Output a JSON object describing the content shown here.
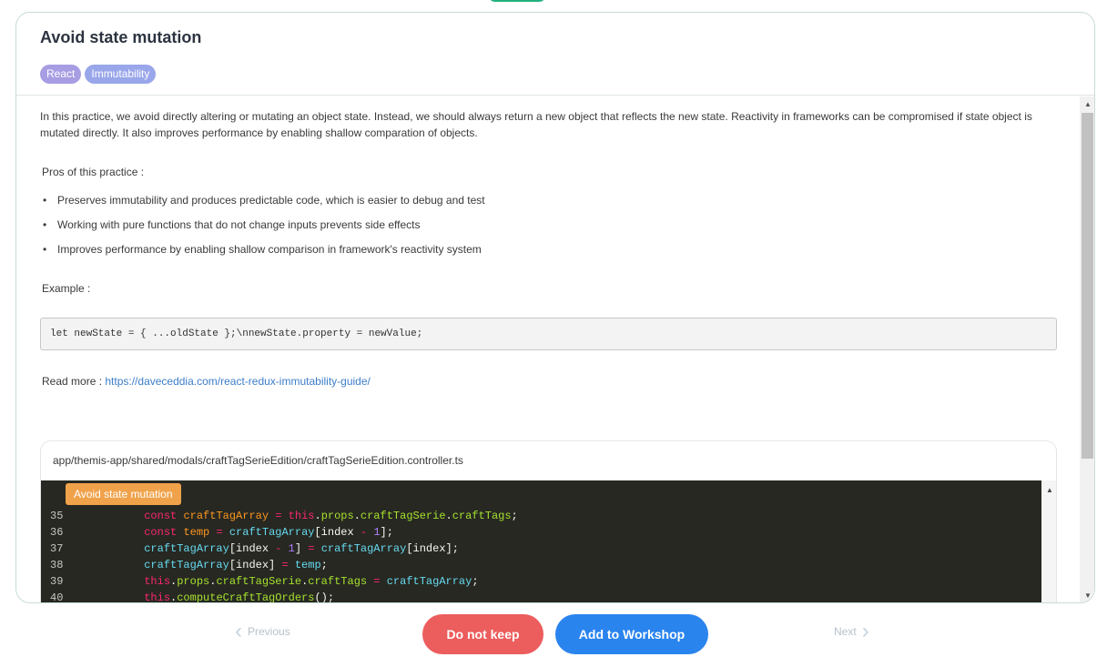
{
  "practice": {
    "title": "Avoid state mutation",
    "tags": [
      "React",
      "Immutability"
    ],
    "description": "In this practice, we avoid directly altering or mutating an object state. Instead, we should always return a new object that reflects the new state. Reactivity in frameworks can be compromised if state object is mutated directly. It also improves performance by enabling shallow comparation of objects.",
    "pros_label": "Pros of this practice :",
    "pros": [
      "Preserves immutability and produces predictable code, which is easier to debug and test",
      "Working with pure functions that do not change inputs prevents side effects",
      "Improves performance by enabling shallow comparison in framework's reactivity system"
    ],
    "example_label": "Example :",
    "example_code": "let newState = { ...oldState };\\nnewState.property = newValue;",
    "read_more_label": "Read more : ",
    "read_more_url": "https://daveceddia.com/react-redux-immutability-guide/"
  },
  "code_snippet": {
    "file_path": "app/themis-app/shared/modals/craftTagSerieEdition/craftTagSerieEdition.controller.ts",
    "badge": "Avoid state mutation",
    "line_numbers": [
      "35",
      "36",
      "37",
      "38",
      "39",
      "40"
    ]
  },
  "footer": {
    "previous_label": "Previous",
    "next_label": "Next",
    "do_not_keep_label": "Do not keep",
    "add_label": "Add to Workshop"
  },
  "colors": {
    "accent_blue": "#2a84ee",
    "danger_red": "#ec5d5d",
    "code_bg": "#272822",
    "badge_orange": "#f0a24a"
  }
}
